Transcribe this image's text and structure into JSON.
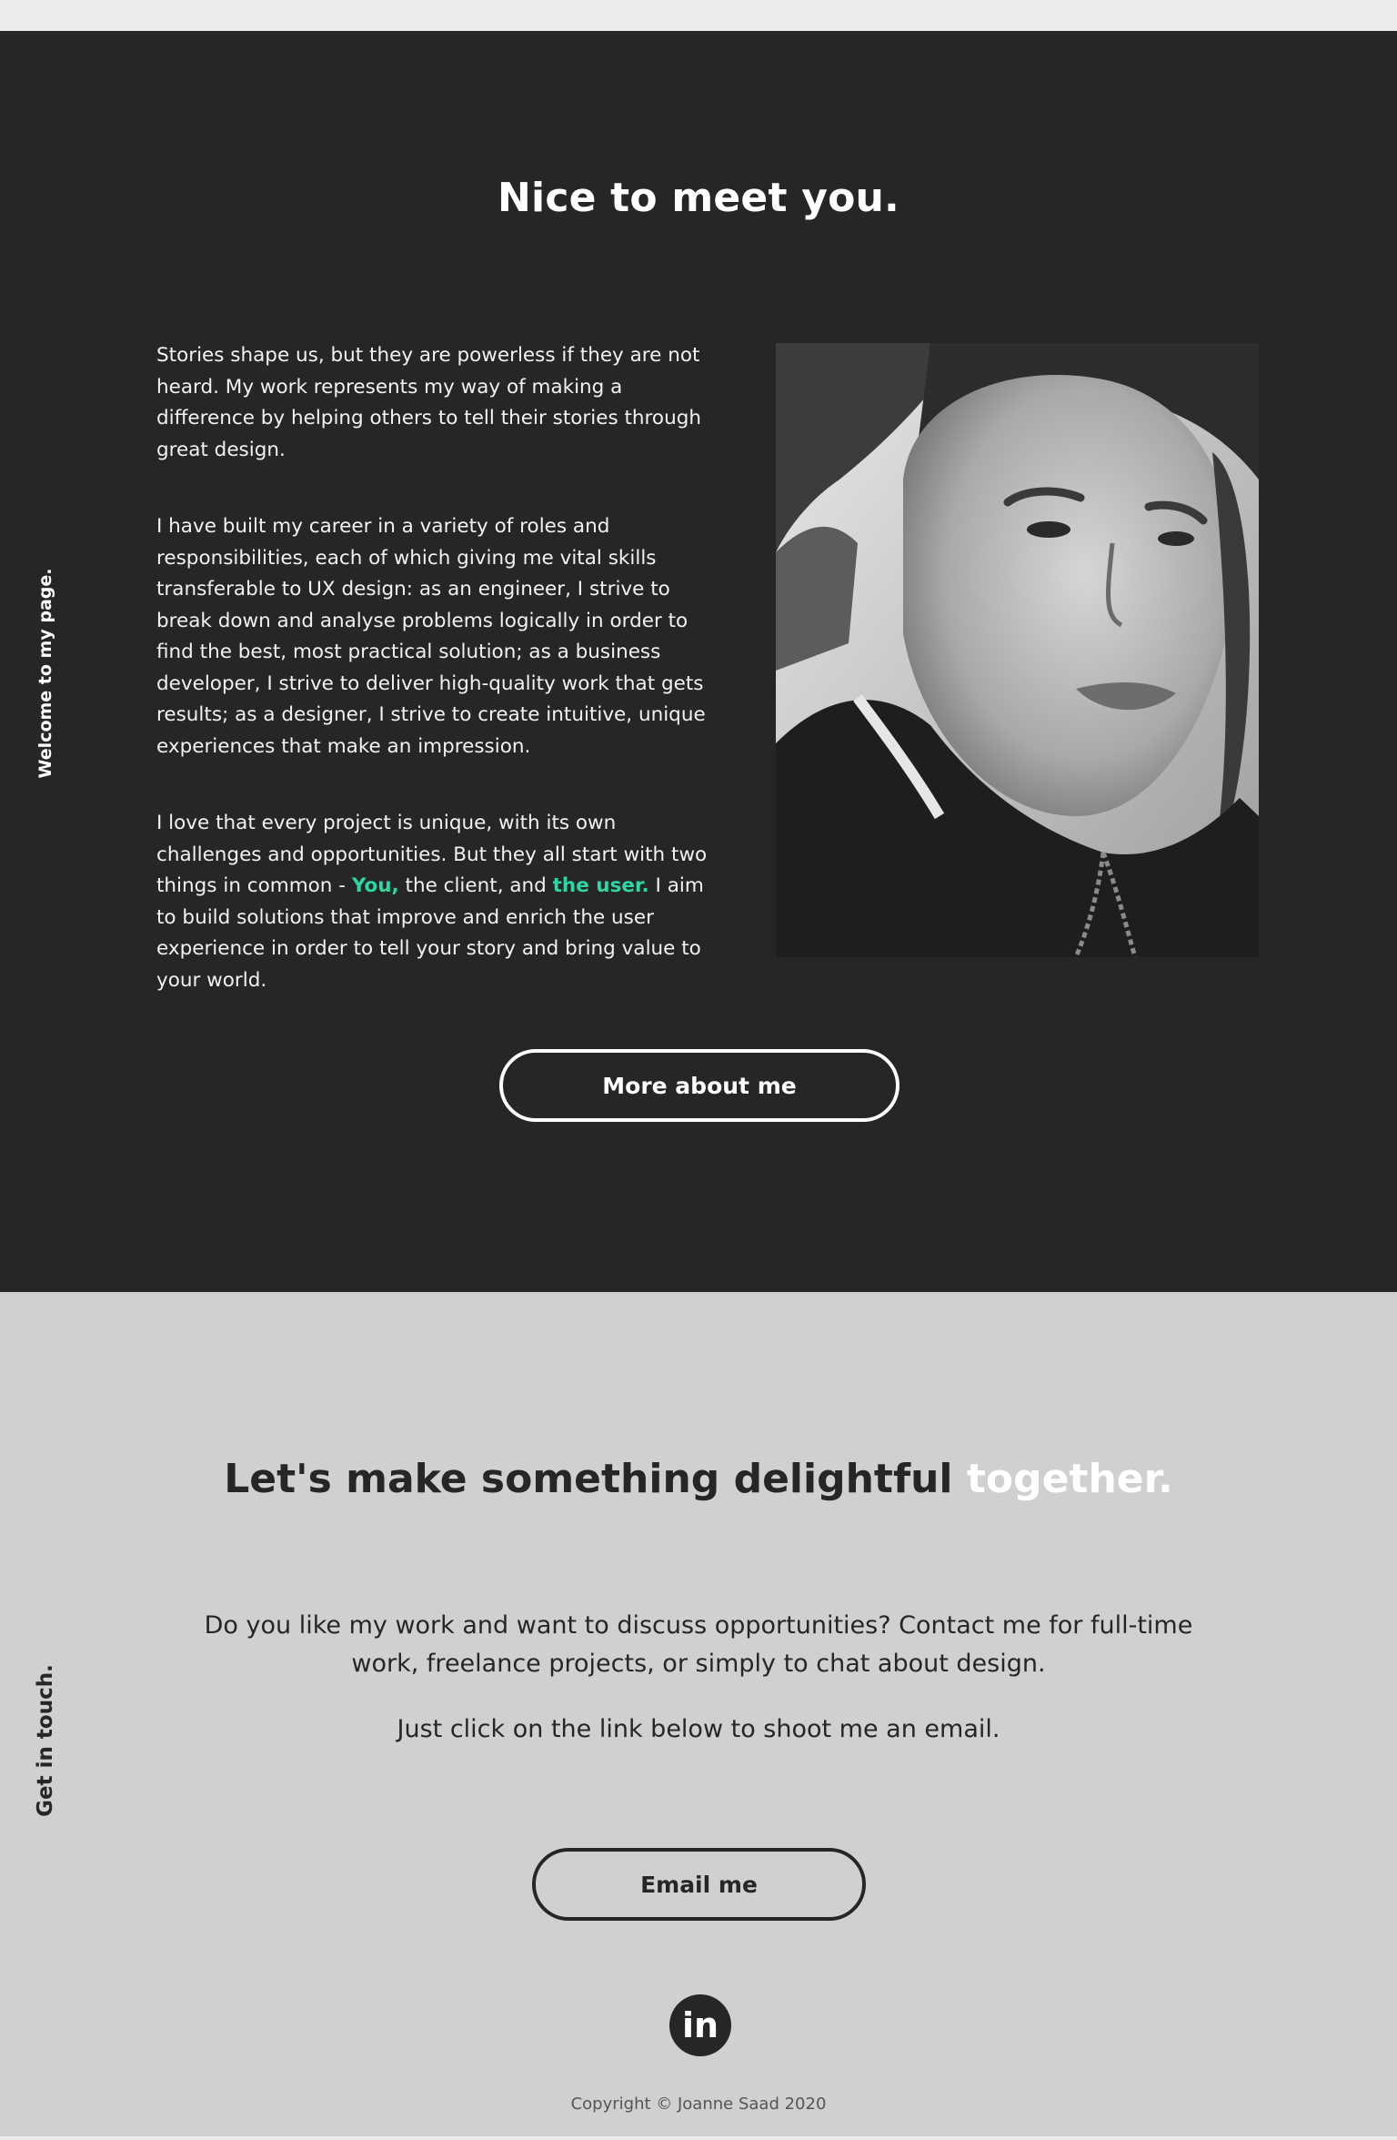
{
  "about": {
    "side_label": "Welcome to my page.",
    "title": "Nice to meet you.",
    "paragraphs": {
      "p1": "Stories shape us, but they are powerless if they are not heard. My work represents my way of making a difference by helping others to tell their stories through great design.",
      "p2": "I have built my career in a variety of roles and responsibilities, each of which giving me vital skills transferable to UX design: as an engineer, I strive to break down and analyse problems logically in order to find the best, most practical solution; as a business developer, I strive to deliver high-quality work that gets results; as a designer, I strive to create intuitive, unique experiences that make an impression.",
      "p3_a": "I love that every project is unique, with its own challenges and opportunities. But they all start with two things in common - ",
      "p3_you": "You,",
      "p3_b": " the client, and ",
      "p3_user": "the user.",
      "p3_c": " I aim to build solutions that improve and enrich the user experience in order to tell your story and bring value to your world."
    },
    "button_label": "More about me"
  },
  "contact": {
    "side_label": "Get in touch.",
    "title_a": "Let's make something delightful ",
    "title_b": "together.",
    "text_1": "Do you like my work and want to discuss opportunities? Contact me for full-time work, freelance projects, or simply to chat about design.",
    "text_2": "Just click on the link below to shoot me an email.",
    "button_label": "Email me",
    "linkedin_icon": "linkedin-icon",
    "linkedin_glyph": "in",
    "copyright": "Copyright © Joanne Saad 2020"
  },
  "colors": {
    "dark": "#262626",
    "light_section": "#d0d0d0",
    "accent": "#2ed6a3"
  }
}
